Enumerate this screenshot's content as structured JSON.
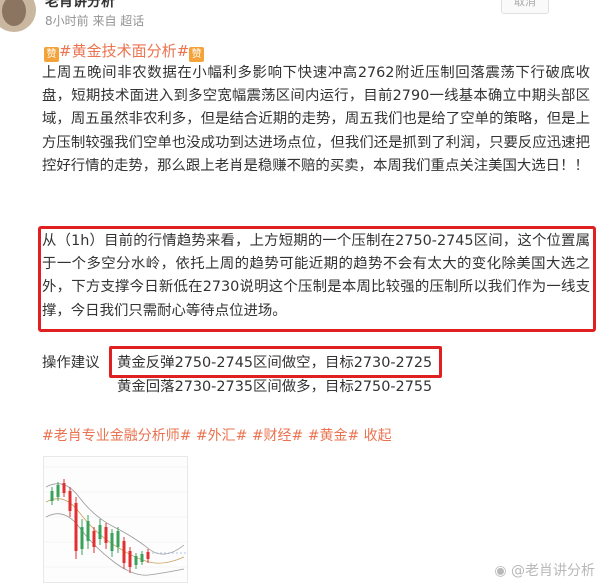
{
  "author": {
    "name": "老肖讲分析"
  },
  "meta": {
    "time": "8小时前",
    "source": "来自 超话"
  },
  "follow_button": "取消",
  "topic": {
    "text": "#黄金技术面分析#",
    "badge": "赞"
  },
  "body": {
    "para1": "上周五晚间非农数据在小幅利多影响下快速冲高2762附近压制回落震荡下行破底收盘，短期技术面进入到多空宽幅震荡区间内运行，目前2790一线基本确立中期头部区域，周五虽然非农利多，但是结合近期的走势，周五我们也是给了空单的策略，但是上方压制较强我们空单也没成功到达进场点位，但我们还是抓到了利润，只要反应迅速把控好行情的走势，那么跟上老肖是稳赚不赔的买卖，本周我们重点关注美国大选日！！",
    "para2": "从（1h）目前的行情趋势来看，上方短期的一个压制在2750-2745区间，这个位置属于一个多空分水岭，依托上周的趋势可能近期的趋势不会有太大的变化除美国大选之外，下方支撑今日新低在2730说明这个压制是本周比较强的压制所以我们作为一线支撑，今日我们只需耐心等待点位进场。"
  },
  "advice": {
    "label": "操作建议",
    "line1": "黄金反弹2750-2745区间做空，目标2730-2725",
    "line2": "黄金回落2730-2735区间做多，目标2750-2755"
  },
  "hashtags": "#老肖专业金融分析师# #外汇# #财经# #黄金# 收起",
  "watermark": "@老肖讲分析",
  "colors": {
    "accent": "#eb7350",
    "highlight_border": "#e02020",
    "up_candle": "#3aa15a",
    "down_candle": "#e03030"
  }
}
